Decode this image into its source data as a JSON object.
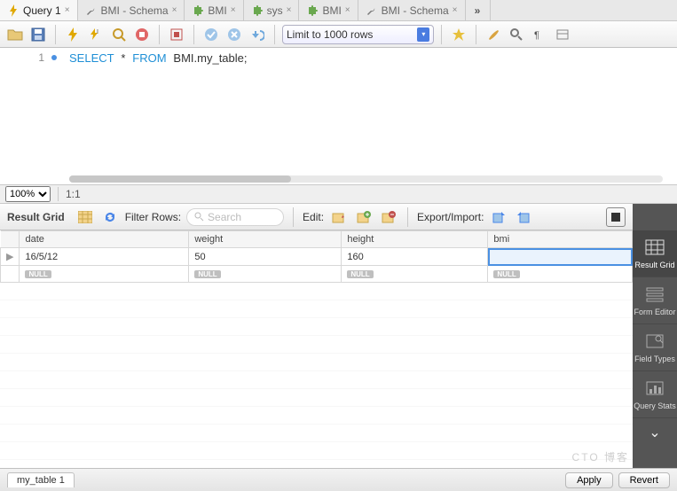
{
  "tabs": [
    {
      "label": "Query 1",
      "icon": "bolt"
    },
    {
      "label": "BMI - Schema",
      "icon": "wrench"
    },
    {
      "label": "BMI",
      "icon": "puzzle"
    },
    {
      "label": "sys",
      "icon": "puzzle"
    },
    {
      "label": "BMI",
      "icon": "puzzle"
    },
    {
      "label": "BMI - Schema",
      "icon": "wrench"
    }
  ],
  "toolbar": {
    "limit_label": "Limit to 1000 rows"
  },
  "editor": {
    "line_no": "1",
    "sql": {
      "kw1": "SELECT",
      "star": "*",
      "kw2": "FROM",
      "rest": "BMI.my_table;"
    }
  },
  "status": {
    "zoom": "100%",
    "pos": "1:1"
  },
  "result_toolbar": {
    "title": "Result Grid",
    "filter_label": "Filter Rows:",
    "search_placeholder": "Search",
    "edit_label": "Edit:",
    "export_label": "Export/Import:"
  },
  "columns": [
    "date",
    "weight",
    "height",
    "bmi"
  ],
  "rows": [
    {
      "date": "16/5/12",
      "weight": "50",
      "height": "160",
      "bmi": ""
    }
  ],
  "null_label": "NULL",
  "rail": [
    {
      "label": "Result Grid"
    },
    {
      "label": "Form Editor"
    },
    {
      "label": "Field Types"
    },
    {
      "label": "Query Stats"
    }
  ],
  "footer": {
    "sheet": "my_table 1",
    "apply": "Apply",
    "revert": "Revert"
  },
  "watermark": "CTO 博客"
}
